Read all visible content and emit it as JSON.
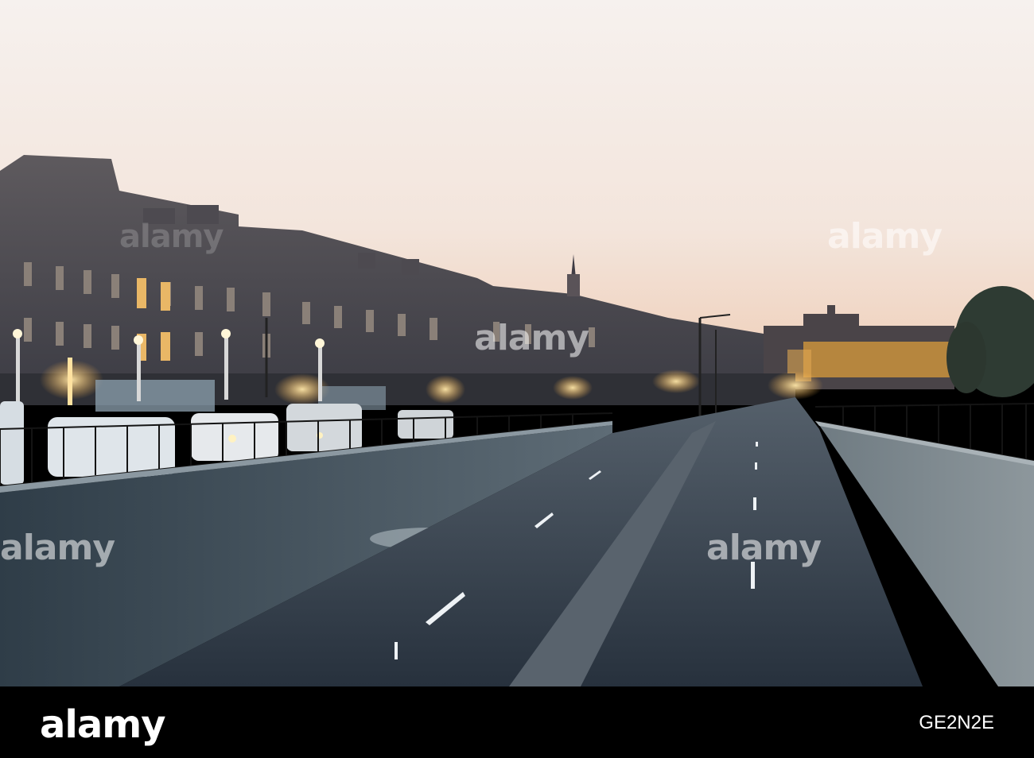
{
  "watermark": {
    "brand": "alamy"
  },
  "footer": {
    "logo": "alamy",
    "image_id": "GE2N2E"
  },
  "colors": {
    "sky_top": "#f6f1ee",
    "sky_horizon": "#f1d7c4",
    "road": "#3a4552",
    "wall": "#6d7c86",
    "lamp": "#ffd88a",
    "footer_bg": "#000000"
  }
}
